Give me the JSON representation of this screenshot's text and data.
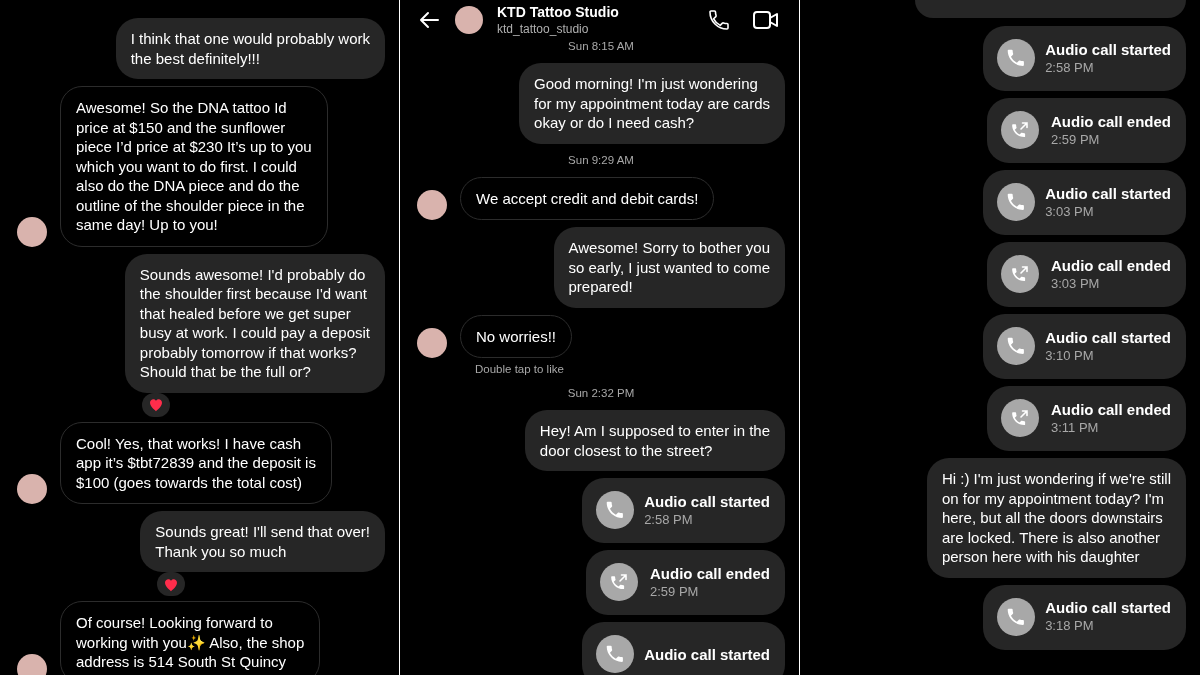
{
  "panels": [
    {
      "messages": [
        {
          "kind": "sent",
          "text": "I think that one would probably work\nthe best definitely!!!",
          "reacted": false
        },
        {
          "kind": "received",
          "text": "Awesome! So the DNA tattoo Id\nprice at $150 and the sunflower\npiece I’d price at $230 It’s up to you\nwhich you want to do first. I could\nalso do the DNA piece and do the\noutline of the shoulder piece in the\nsame day! Up to you!"
        },
        {
          "kind": "sent",
          "text": "Sounds awesome! I'd probably do\nthe shoulder first because I'd want\nthat healed before we get super\nbusy at work. I could pay a deposit\nprobably tomorrow if that works?\nShould that be the full or?",
          "reacted": true
        },
        {
          "kind": "received",
          "text": "Cool! Yes, that works! I have cash\napp it’s $tbt72839 and the deposit is\n$100 (goes towards the total cost)"
        },
        {
          "kind": "sent",
          "text": "Sounds great! I'll send that over!\nThank you so much",
          "reacted": true
        },
        {
          "kind": "received",
          "text": "Of course! Looking forward to\nworking with you✨ Also, the shop\naddress is 514 South St Quincy"
        }
      ]
    },
    {
      "header": {
        "title": "KTD Tattoo Studio",
        "username": "ktd_tattoo_studio"
      },
      "messages": [
        {
          "kind": "timestamp",
          "text": "Sun 8:15 AM"
        },
        {
          "kind": "sent",
          "text": "Good morning! I'm just wondering\nfor my appointment today are cards\nokay or do I need cash?",
          "reacted": false
        },
        {
          "kind": "timestamp",
          "text": "Sun 9:29 AM"
        },
        {
          "kind": "received",
          "text": "We accept credit and debit cards!"
        },
        {
          "kind": "sent",
          "text": "Awesome! Sorry to bother you\nso early, I just wanted to come\nprepared!",
          "reacted": false
        },
        {
          "kind": "received",
          "text": "No worries!!"
        },
        {
          "kind": "hint",
          "text": "Double tap to like"
        },
        {
          "kind": "timestamp",
          "text": "Sun 2:32 PM"
        },
        {
          "kind": "sent",
          "text": "Hey! Am I supposed to enter in the\ndoor closest to the street?",
          "reacted": false
        },
        {
          "kind": "call",
          "ended": false,
          "title": "Audio call started",
          "time": "2:58 PM"
        },
        {
          "kind": "call",
          "ended": true,
          "title": "Audio call ended",
          "time": "2:59 PM"
        },
        {
          "kind": "call",
          "ended": false,
          "title": "Audio call started"
        }
      ]
    },
    {
      "messages": [
        {
          "kind": "fragment"
        },
        {
          "kind": "call",
          "ended": false,
          "title": "Audio call started",
          "time": "2:58 PM"
        },
        {
          "kind": "call",
          "ended": true,
          "title": "Audio call ended",
          "time": "2:59 PM"
        },
        {
          "kind": "call",
          "ended": false,
          "title": "Audio call started",
          "time": "3:03 PM"
        },
        {
          "kind": "call",
          "ended": true,
          "title": "Audio call ended",
          "time": "3:03 PM"
        },
        {
          "kind": "call",
          "ended": false,
          "title": "Audio call started",
          "time": "3:10 PM"
        },
        {
          "kind": "call",
          "ended": true,
          "title": "Audio call ended",
          "time": "3:11 PM"
        },
        {
          "kind": "sent",
          "text": "Hi :) I'm just wondering if we're still\non for my appointment today? I'm\nhere, but all the doors downstairs\nare locked. There is also another\nperson here with his daughter",
          "reacted": false
        },
        {
          "kind": "call",
          "ended": false,
          "title": "Audio call started",
          "time": "3:18 PM"
        }
      ]
    }
  ]
}
